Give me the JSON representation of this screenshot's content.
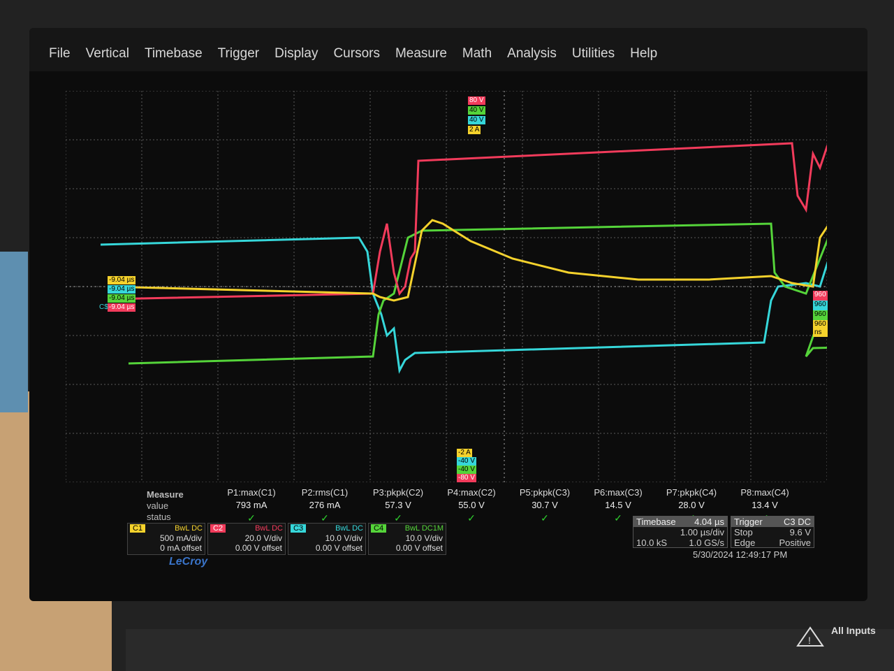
{
  "menu": [
    "File",
    "Vertical",
    "Timebase",
    "Trigger",
    "Display",
    "Cursors",
    "Measure",
    "Math",
    "Analysis",
    "Utilities",
    "Help"
  ],
  "colors": {
    "c1": "#f5d22c",
    "c2": "#f23b5b",
    "c3": "#36d7da",
    "c4": "#55d43a",
    "grid": "#6a6a6a"
  },
  "top_markers": [
    "80 V",
    "40 V",
    "40 V",
    "2 A"
  ],
  "bottom_markers": [
    "-2 A",
    "-40 V",
    "-40 V",
    "-80 V"
  ],
  "left_markers": [
    "-9.04 µs",
    "-9.04 µs",
    "-9.04 µs",
    "-9.04 µs"
  ],
  "left_label": "C$",
  "right_markers": [
    "960 ns",
    "960 ns",
    "960 ns",
    "960 ns"
  ],
  "measure": {
    "title": "Measure",
    "row_value": "value",
    "row_status": "status",
    "params": [
      {
        "name": "P1:max(C1)",
        "value": "793 mA"
      },
      {
        "name": "P2:rms(C1)",
        "value": "276 mA"
      },
      {
        "name": "P3:pkpk(C2)",
        "value": "57.3 V"
      },
      {
        "name": "P4:max(C2)",
        "value": "55.0 V"
      },
      {
        "name": "P5:pkpk(C3)",
        "value": "30.7 V"
      },
      {
        "name": "P6:max(C3)",
        "value": "14.5 V"
      },
      {
        "name": "P7:pkpk(C4)",
        "value": "28.0 V"
      },
      {
        "name": "P8:max(C4)",
        "value": "13.4 V"
      }
    ],
    "check": "✓"
  },
  "channels": [
    {
      "tag": "C1",
      "mode": "BwL DC",
      "scale": "500 mA/div",
      "offset": "0 mA offset"
    },
    {
      "tag": "C2",
      "mode": "BwL DC",
      "scale": "20.0 V/div",
      "offset": "0.00 V offset"
    },
    {
      "tag": "C3",
      "mode": "BwL DC",
      "scale": "10.0 V/div",
      "offset": "0.00 V offset"
    },
    {
      "tag": "C4",
      "mode": "BwL DC1M",
      "scale": "10.0 V/div",
      "offset": "0.00 V offset"
    }
  ],
  "timebase": {
    "label": "Timebase",
    "delay": "4.04 µs",
    "per_div": "1.00 µs/div",
    "samples": "10.0 kS",
    "rate": "1.0 GS/s"
  },
  "trigger": {
    "label": "Trigger",
    "chan": "C3",
    "coupling": "DC",
    "mode": "Stop",
    "level": "9.6 V",
    "type": "Edge",
    "slope": "Positive"
  },
  "datetime": "5/30/2024 12:49:17 PM",
  "brand": "LeCroy",
  "panel_text": "All Inputs"
}
